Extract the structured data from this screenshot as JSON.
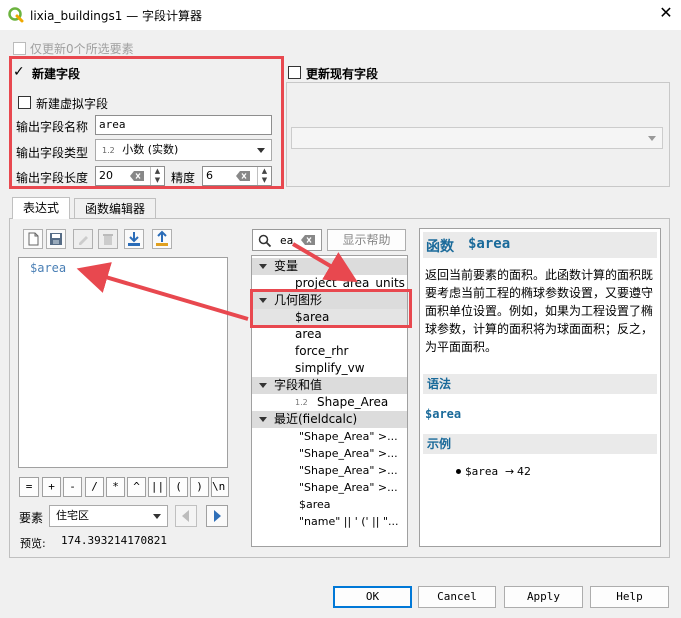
{
  "window": {
    "title": "lixia_buildings1 — 字段计算器",
    "close": "✕"
  },
  "top": {
    "only_selected": "仅更新0个所选要素"
  },
  "new_field": {
    "group_label": "新建字段",
    "virtual_label": "新建虚拟字段",
    "name_label": "输出字段名称",
    "name_value": "area",
    "type_label": "输出字段类型",
    "type_prefix": "1.2",
    "type_value": "小数 (实数)",
    "length_label": "输出字段长度",
    "length_value": "20",
    "precision_label": "精度",
    "precision_value": "6"
  },
  "update_field": {
    "group_label": "更新现有字段",
    "combo_value": ""
  },
  "tabs": [
    {
      "label": "表达式",
      "active": true
    },
    {
      "label": "函数编辑器",
      "active": false
    }
  ],
  "editor": {
    "expression": "$area"
  },
  "operators": [
    "=",
    "+",
    "-",
    "/",
    "*",
    "^",
    "||",
    "(",
    ")",
    "\\n'"
  ],
  "feature": {
    "label": "要素",
    "value": "住宅区"
  },
  "preview": {
    "label": "预览:",
    "value": "174.393214170821"
  },
  "search": {
    "value": "ea",
    "show_help": "显示帮助"
  },
  "tree": [
    {
      "type": "group",
      "label": "变量"
    },
    {
      "type": "item",
      "label": "project_area_units"
    },
    {
      "type": "group",
      "label": "几何图形"
    },
    {
      "type": "item",
      "label": "$area",
      "selected": true
    },
    {
      "type": "item",
      "label": "area"
    },
    {
      "type": "item",
      "label": "force_rhr"
    },
    {
      "type": "item",
      "label": "simplify_vw"
    },
    {
      "type": "group",
      "label": "字段和值"
    },
    {
      "type": "field",
      "prefix": "1.2",
      "label": "Shape_Area"
    },
    {
      "type": "group",
      "label": "最近(fieldcalc)"
    },
    {
      "type": "recent",
      "label": "\"Shape_Area\" >..."
    },
    {
      "type": "recent",
      "label": "\"Shape_Area\" >..."
    },
    {
      "type": "recent",
      "label": "\"Shape_Area\" >..."
    },
    {
      "type": "recent",
      "label": "\"Shape_Area\" >..."
    },
    {
      "type": "recent",
      "label": "$area"
    },
    {
      "type": "recent",
      "label": "\"name\" || ' (' || \"..."
    }
  ],
  "help": {
    "title_prefix": "函数 ",
    "title_name": "$area",
    "description": "返回当前要素的面积。此函数计算的面积既要考虑当前工程的椭球参数设置，又要遵守面积单位设置。例如，如果为工程设置了椭球参数，计算的面积将为球面面积；反之，为平面面积。",
    "syntax_header": "语法",
    "syntax": "$area",
    "examples_header": "示例",
    "example_code": "$area",
    "example_arrow": "→",
    "example_result": "42"
  },
  "buttons": {
    "ok": "OK",
    "cancel": "Cancel",
    "apply": "Apply",
    "help": "Help"
  },
  "colors": {
    "highlight": "#e8484f",
    "help_title": "#1a6a9a",
    "keyword": "#4a7fb5"
  }
}
